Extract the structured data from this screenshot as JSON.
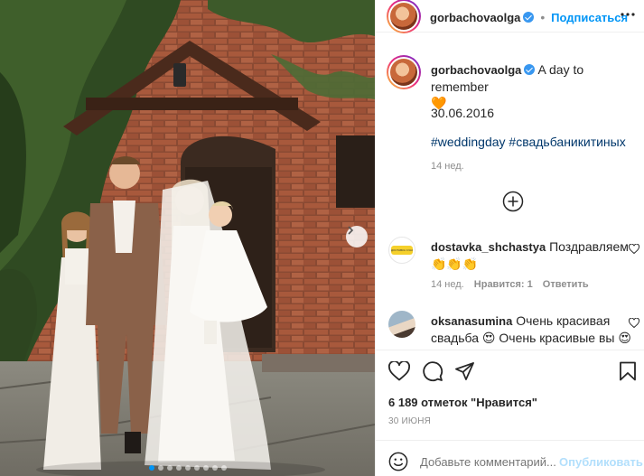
{
  "post": {
    "username": "gorbachovaolga",
    "follow_label": "Подписаться",
    "header_sep": "•",
    "caption_text": "A day to remember",
    "caption_emoji": "🧡",
    "date_line": "30.06.2016",
    "hashtag_1": "#weddingday",
    "hashtag_2": "#свадьбаникитиных",
    "age": "14 нед."
  },
  "comments": [
    {
      "username": "dostavka_shchastya",
      "text": "Поздравляем",
      "emoji": "👏👏👏",
      "age": "14 нед.",
      "likes": "Нравится: 1",
      "reply": "Ответить",
      "avatar_text": "ДОСТАВКА СЧАСТЬЯ"
    },
    {
      "username": "oksanasumina",
      "text": "Очень красивая свадьба",
      "emoji1": "😍",
      "text2": "Очень красивые вы",
      "emoji2": "😍"
    }
  ],
  "stats": {
    "likes_text": "6 189 отметок \"Нравится\"",
    "date": "30 ИЮНЯ"
  },
  "composer": {
    "placeholder": "Добавьте комментарий...",
    "publish_label": "Опубликовать"
  },
  "carousel": {
    "active_index": 0,
    "count": 9
  },
  "colors": {
    "accent": "#0095f6",
    "verified": "#3897f0",
    "hashtag": "#00376b",
    "muted": "#8e8e8e"
  }
}
